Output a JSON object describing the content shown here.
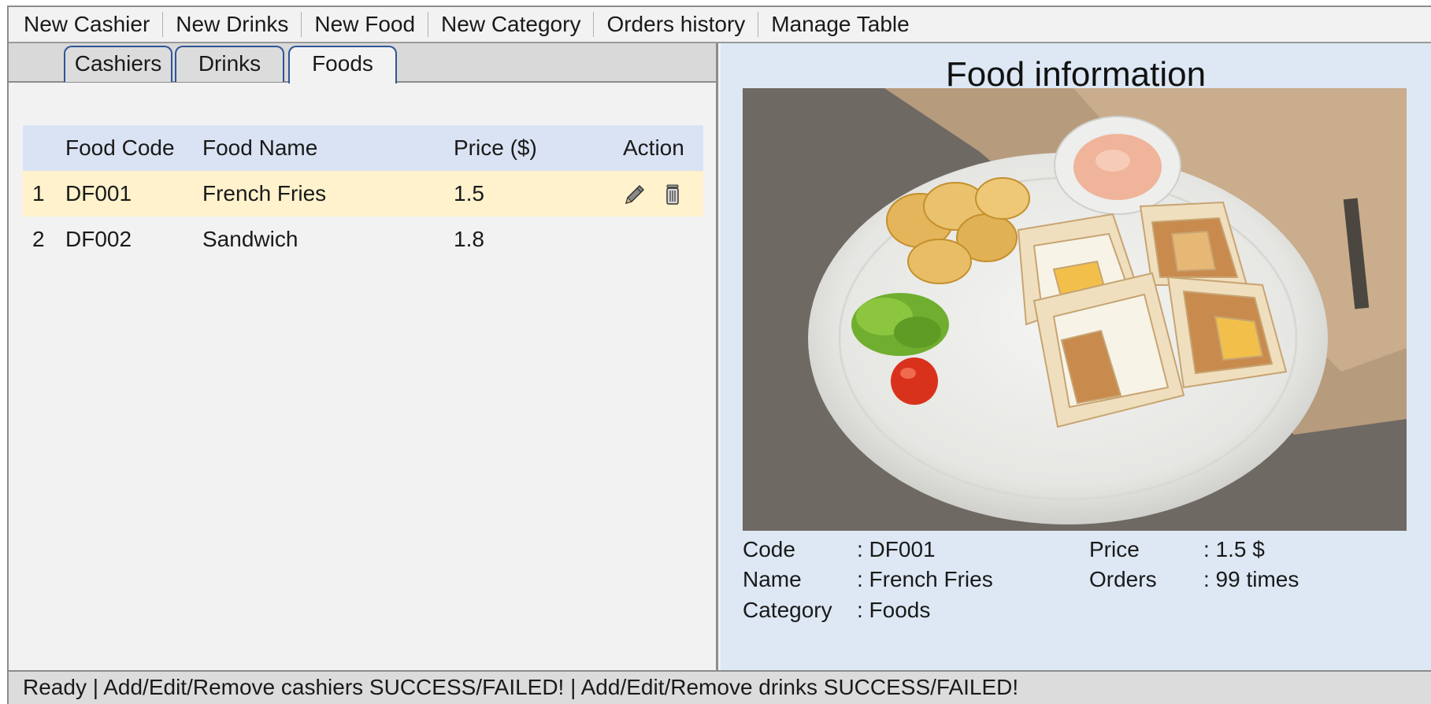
{
  "menu": {
    "items": [
      {
        "label": "New Cashier"
      },
      {
        "label": "New Drinks"
      },
      {
        "label": "New Food"
      },
      {
        "label": "New Category"
      },
      {
        "label": "Orders history"
      },
      {
        "label": "Manage Table"
      }
    ]
  },
  "tabs": {
    "items": [
      {
        "label": "Cashiers"
      },
      {
        "label": "Drinks"
      },
      {
        "label": "Foods"
      }
    ],
    "active": "Foods"
  },
  "table": {
    "headers": {
      "code": "Food Code",
      "name": "Food Name",
      "price": "Price ($)",
      "action": "Action"
    },
    "rows": [
      {
        "index": "1",
        "code": "DF001",
        "name": "French Fries",
        "price": "1.5",
        "selected": true
      },
      {
        "index": "2",
        "code": "DF002",
        "name": "Sandwich",
        "price": "1.8",
        "selected": false
      }
    ],
    "actions": [
      "pencil-icon",
      "trash-icon"
    ]
  },
  "details": {
    "title": "Food information",
    "image_description": "Plate of club sandwiches with potato chips, lettuce, tomato and dipping sauce",
    "code_label": "Code",
    "code_value": ": DF001",
    "name_label": "Name",
    "name_value": ": French Fries",
    "category_label": "Category",
    "category_value": ": Foods",
    "price_label": "Price",
    "price_value": ": 1.5 $",
    "orders_label": "Orders",
    "orders_value": ": 99 times"
  },
  "status": {
    "text": "Ready | Add/Edit/Remove cashiers SUCCESS/FAILED! | Add/Edit/Remove drinks SUCCESS/FAILED!"
  },
  "colors": {
    "header_row": "#dae3f3",
    "selected_row": "#fff2cc",
    "right_panel": "#dde8f4",
    "tab_border": "#2f5597"
  }
}
